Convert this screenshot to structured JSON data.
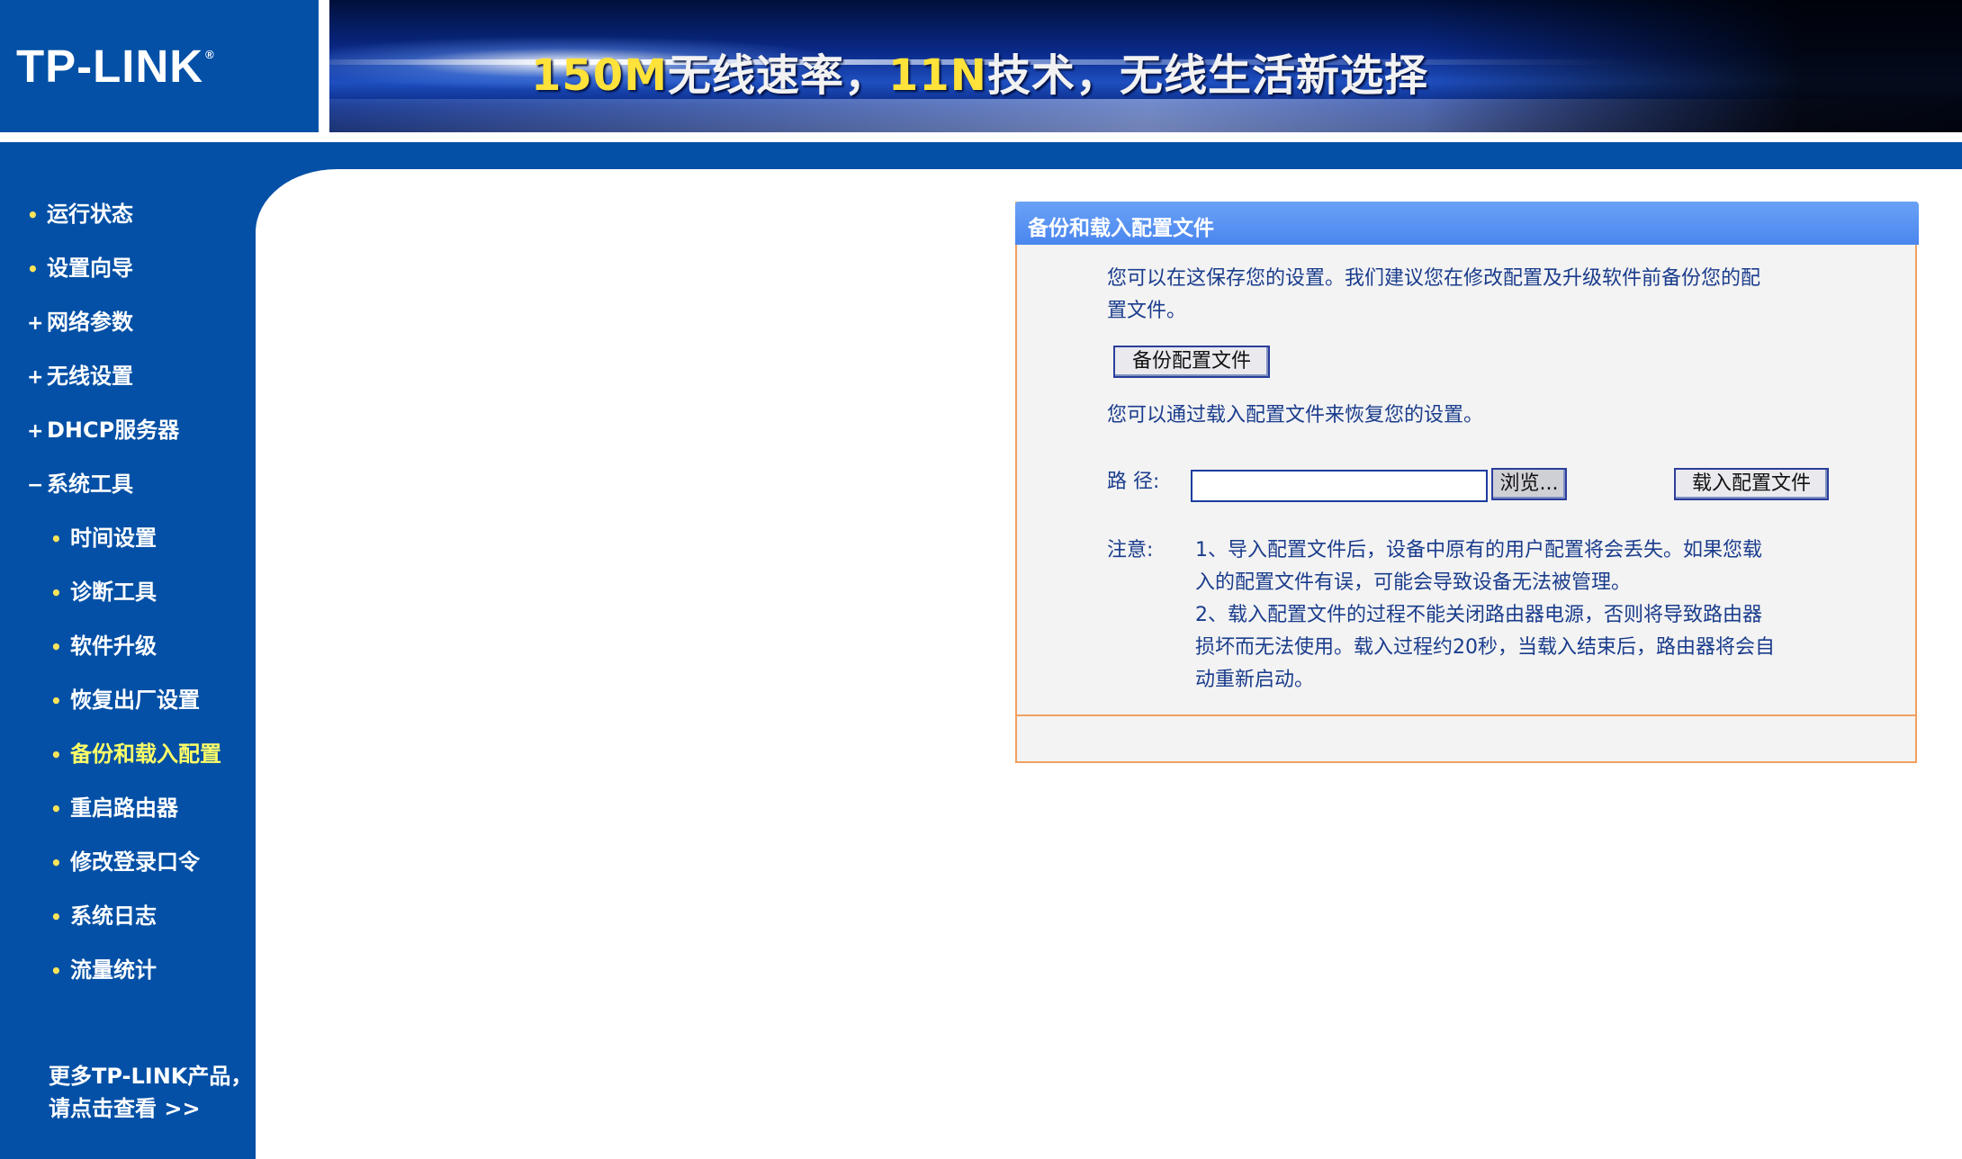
{
  "header": {
    "logo": "TP-LINK",
    "logo_mark": "®",
    "slogan_part1": "150M",
    "slogan_part2": "无线速率，",
    "slogan_part3": "11N",
    "slogan_part4": "技术，无线生活新选择"
  },
  "sidebar": {
    "items": [
      {
        "label": "运行状态",
        "marker": "•"
      },
      {
        "label": "设置向导",
        "marker": "•"
      },
      {
        "label": "网络参数",
        "marker": "+"
      },
      {
        "label": "无线设置",
        "marker": "+"
      },
      {
        "label": "DHCP服务器",
        "marker": "+"
      },
      {
        "label": "系统工具",
        "marker": "−"
      }
    ],
    "subitems": [
      {
        "label": "时间设置"
      },
      {
        "label": "诊断工具"
      },
      {
        "label": "软件升级"
      },
      {
        "label": "恢复出厂设置"
      },
      {
        "label": "备份和载入配置"
      },
      {
        "label": "重启路由器"
      },
      {
        "label": "修改登录口令"
      },
      {
        "label": "系统日志"
      },
      {
        "label": "流量统计"
      }
    ],
    "more_line1": "更多TP-LINK产品，",
    "more_line2": "请点击查看 >>"
  },
  "panel": {
    "title": "备份和载入配置文件",
    "backup_desc_line1": "您可以在这保存您的设置。我们建议您在修改配置及升级软件前备份您的配",
    "backup_desc_line2": "置文件。",
    "backup_button": "备份配置文件",
    "restore_desc": "您可以通过载入配置文件来恢复您的设置。",
    "path_label": "路 径:",
    "path_value": "",
    "browse_button": "浏览...",
    "load_button": "载入配置文件",
    "note_label": "注意:",
    "note_lines": [
      "1、导入配置文件后，设备中原有的用户配置将会丢失。如果您载",
      "入的配置文件有误，可能会导致设备无法被管理。",
      "2、载入配置文件的过程不能关闭路由器电源，否则将导致路由器",
      "损坏而无法使用。载入过程约20秒，当载入结束后，路由器将会自",
      "动重新启动。"
    ]
  },
  "colors": {
    "sidebar_blue": "#0350a6",
    "active_item": "#ffff66",
    "panel_title_bar": "#5a94f2",
    "panel_border": "#f0a060",
    "text_blue": "#1a3c8c"
  }
}
